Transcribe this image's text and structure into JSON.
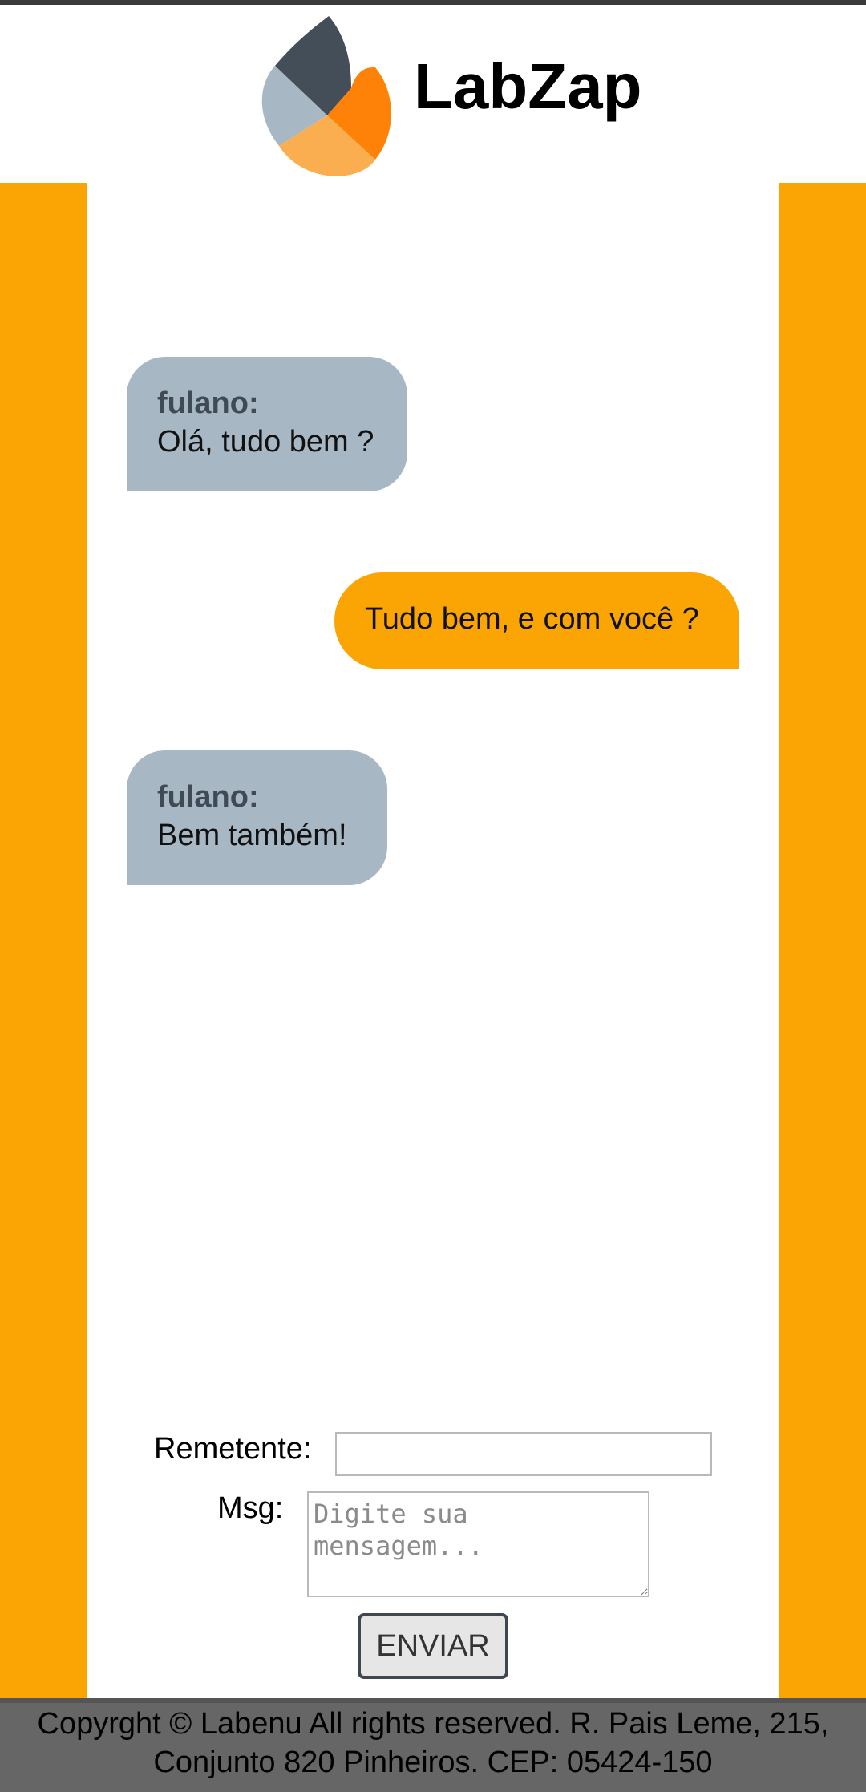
{
  "header": {
    "app_name": "LabZap",
    "logo_icon": "flame-petal-logo-icon"
  },
  "messages": [
    {
      "direction": "in",
      "sender": "fulano:",
      "text": "Olá, tudo bem ?"
    },
    {
      "direction": "out",
      "sender": "",
      "text": "Tudo bem, e com você ?"
    },
    {
      "direction": "in",
      "sender": "fulano:",
      "text": "Bem também!"
    }
  ],
  "form": {
    "sender_label": "Remetente:",
    "sender_value": "",
    "msg_label": "Msg:",
    "msg_placeholder": "Digite sua mensagem...",
    "send_label": "ENVIAR"
  },
  "footer": {
    "line1": "Copyrght © Labenu All rights reserved. R. Pais Leme, 215,",
    "line2": "Conjunto 820 Pinheiros. CEP: 05424-150"
  },
  "colors": {
    "accent": "#fba504",
    "incoming_bubble": "#a7b8c4",
    "footer_bg": "#666666"
  }
}
